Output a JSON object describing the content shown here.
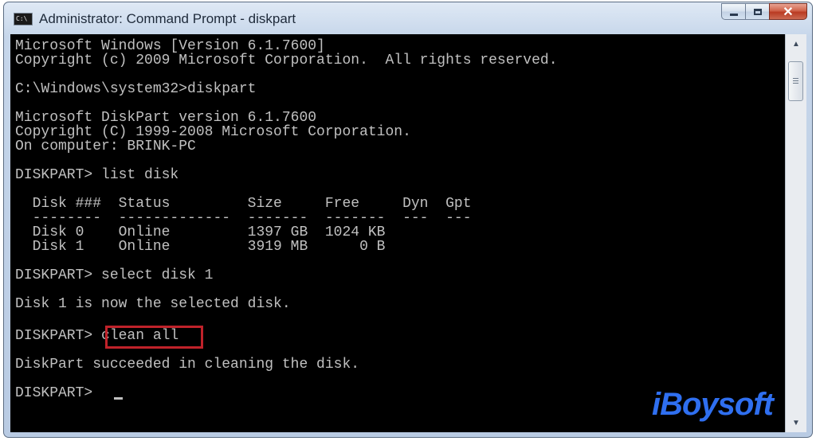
{
  "window": {
    "title": "Administrator: Command Prompt - diskpart",
    "icon_label": "C:\\",
    "buttons": {
      "minimize": "minimize-icon",
      "maximize": "maximize-icon",
      "close": "✕"
    }
  },
  "console": {
    "lines": [
      "Microsoft Windows [Version 6.1.7600]",
      "Copyright (c) 2009 Microsoft Corporation.  All rights reserved.",
      "",
      "C:\\Windows\\system32>diskpart",
      "",
      "Microsoft DiskPart version 6.1.7600",
      "Copyright (C) 1999-2008 Microsoft Corporation.",
      "On computer: BRINK-PC",
      "",
      "DISKPART> list disk",
      "",
      "  Disk ###  Status         Size     Free     Dyn  Gpt",
      "  --------  -------------  -------  -------  ---  ---",
      "  Disk 0    Online         1397 GB  1024 KB",
      "  Disk 1    Online         3919 MB      0 B",
      "",
      "DISKPART> select disk 1",
      "",
      "Disk 1 is now the selected disk.",
      "",
      "DISKPART> clean all",
      "",
      "DiskPart succeeded in cleaning the disk.",
      "",
      "DISKPART> "
    ],
    "highlight_text": "clean all"
  },
  "watermark": "iBoysoft",
  "colors": {
    "console_bg": "#000000",
    "console_text": "#c0c0c0",
    "highlight": "#c0222a",
    "watermark": "#2f6ff0"
  }
}
